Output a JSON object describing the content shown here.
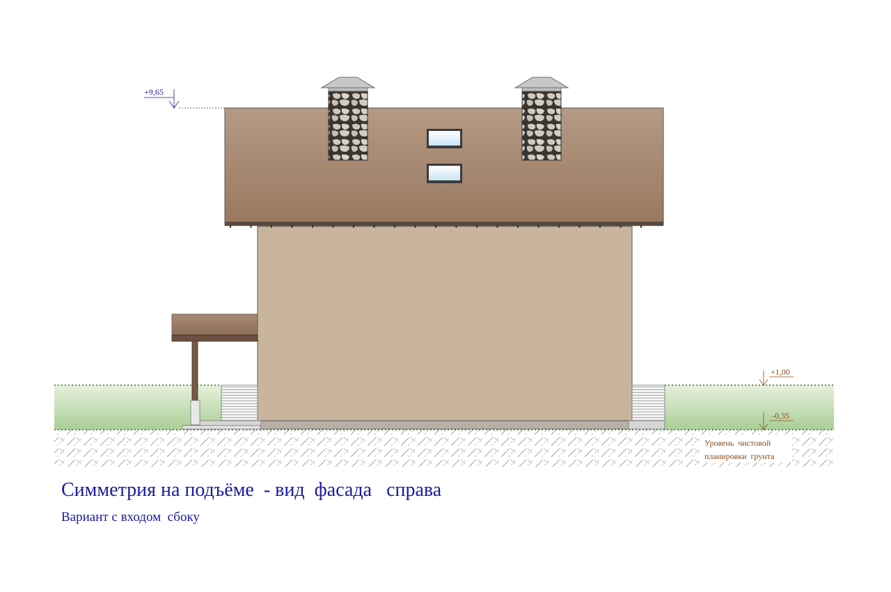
{
  "title": "Симметрия на подъёме  - вид  фасада   справа",
  "subtitle": "Вариант с входом  сбоку",
  "elevations": {
    "ridge": "+9,65",
    "porch": "+1,00",
    "ground": "-0,35"
  },
  "ground_note": {
    "line1": "Уровень  чистовой",
    "line2": "планировки  грунта"
  },
  "colors": {
    "roof": "#a98972",
    "wall": "#c9b59c",
    "grass": "#b8d8a8",
    "annotation_blue": "#1a1aa0",
    "annotation_brown": "#8b4a1a"
  }
}
